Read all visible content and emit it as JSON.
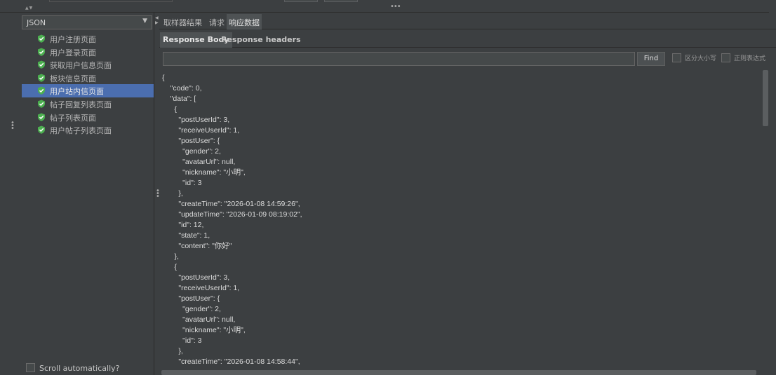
{
  "left": {
    "combo_value": "JSON",
    "tree_items": [
      {
        "label": "用户注册页面",
        "selected": false
      },
      {
        "label": "用户登录页面",
        "selected": false
      },
      {
        "label": "获取用户信息页面",
        "selected": false
      },
      {
        "label": "板块信息页面",
        "selected": false
      },
      {
        "label": "用户站内信页面",
        "selected": true
      },
      {
        "label": "帖子回复列表页面",
        "selected": false
      },
      {
        "label": "帖子列表页面",
        "selected": false
      },
      {
        "label": "用户帖子列表页面",
        "selected": false
      }
    ],
    "scroll_auto_label": "Scroll automatically?"
  },
  "tabs": {
    "sampler_result": "取样器结果",
    "request": "请求",
    "response_data": "响应数据"
  },
  "subtabs": {
    "response_body": "Response Body",
    "response_headers": "Response headers"
  },
  "search": {
    "value": "",
    "find_label": "Find",
    "case_sensitive_label": "区分大小写",
    "regex_label": "正则表达式"
  },
  "icons": {
    "status_icon": "success-shield-icon",
    "status_color": "#4caf50",
    "selection_color": "#4b6eaf"
  },
  "response_body": "{\n    \"code\": 0,\n    \"data\": [\n      {\n        \"postUserId\": 3,\n        \"receiveUserId\": 1,\n        \"postUser\": {\n          \"gender\": 2,\n          \"avatarUrl\": null,\n          \"nickname\": \"小明\",\n          \"id\": 3\n        },\n        \"createTime\": \"2026-01-08 14:59:26\",\n        \"updateTime\": \"2026-01-09 08:19:02\",\n        \"id\": 12,\n        \"state\": 1,\n        \"content\": \"你好\"\n      },\n      {\n        \"postUserId\": 3,\n        \"receiveUserId\": 1,\n        \"postUser\": {\n          \"gender\": 2,\n          \"avatarUrl\": null,\n          \"nickname\": \"小明\",\n          \"id\": 3\n        },\n        \"createTime\": \"2026-01-08 14:58:44\","
}
